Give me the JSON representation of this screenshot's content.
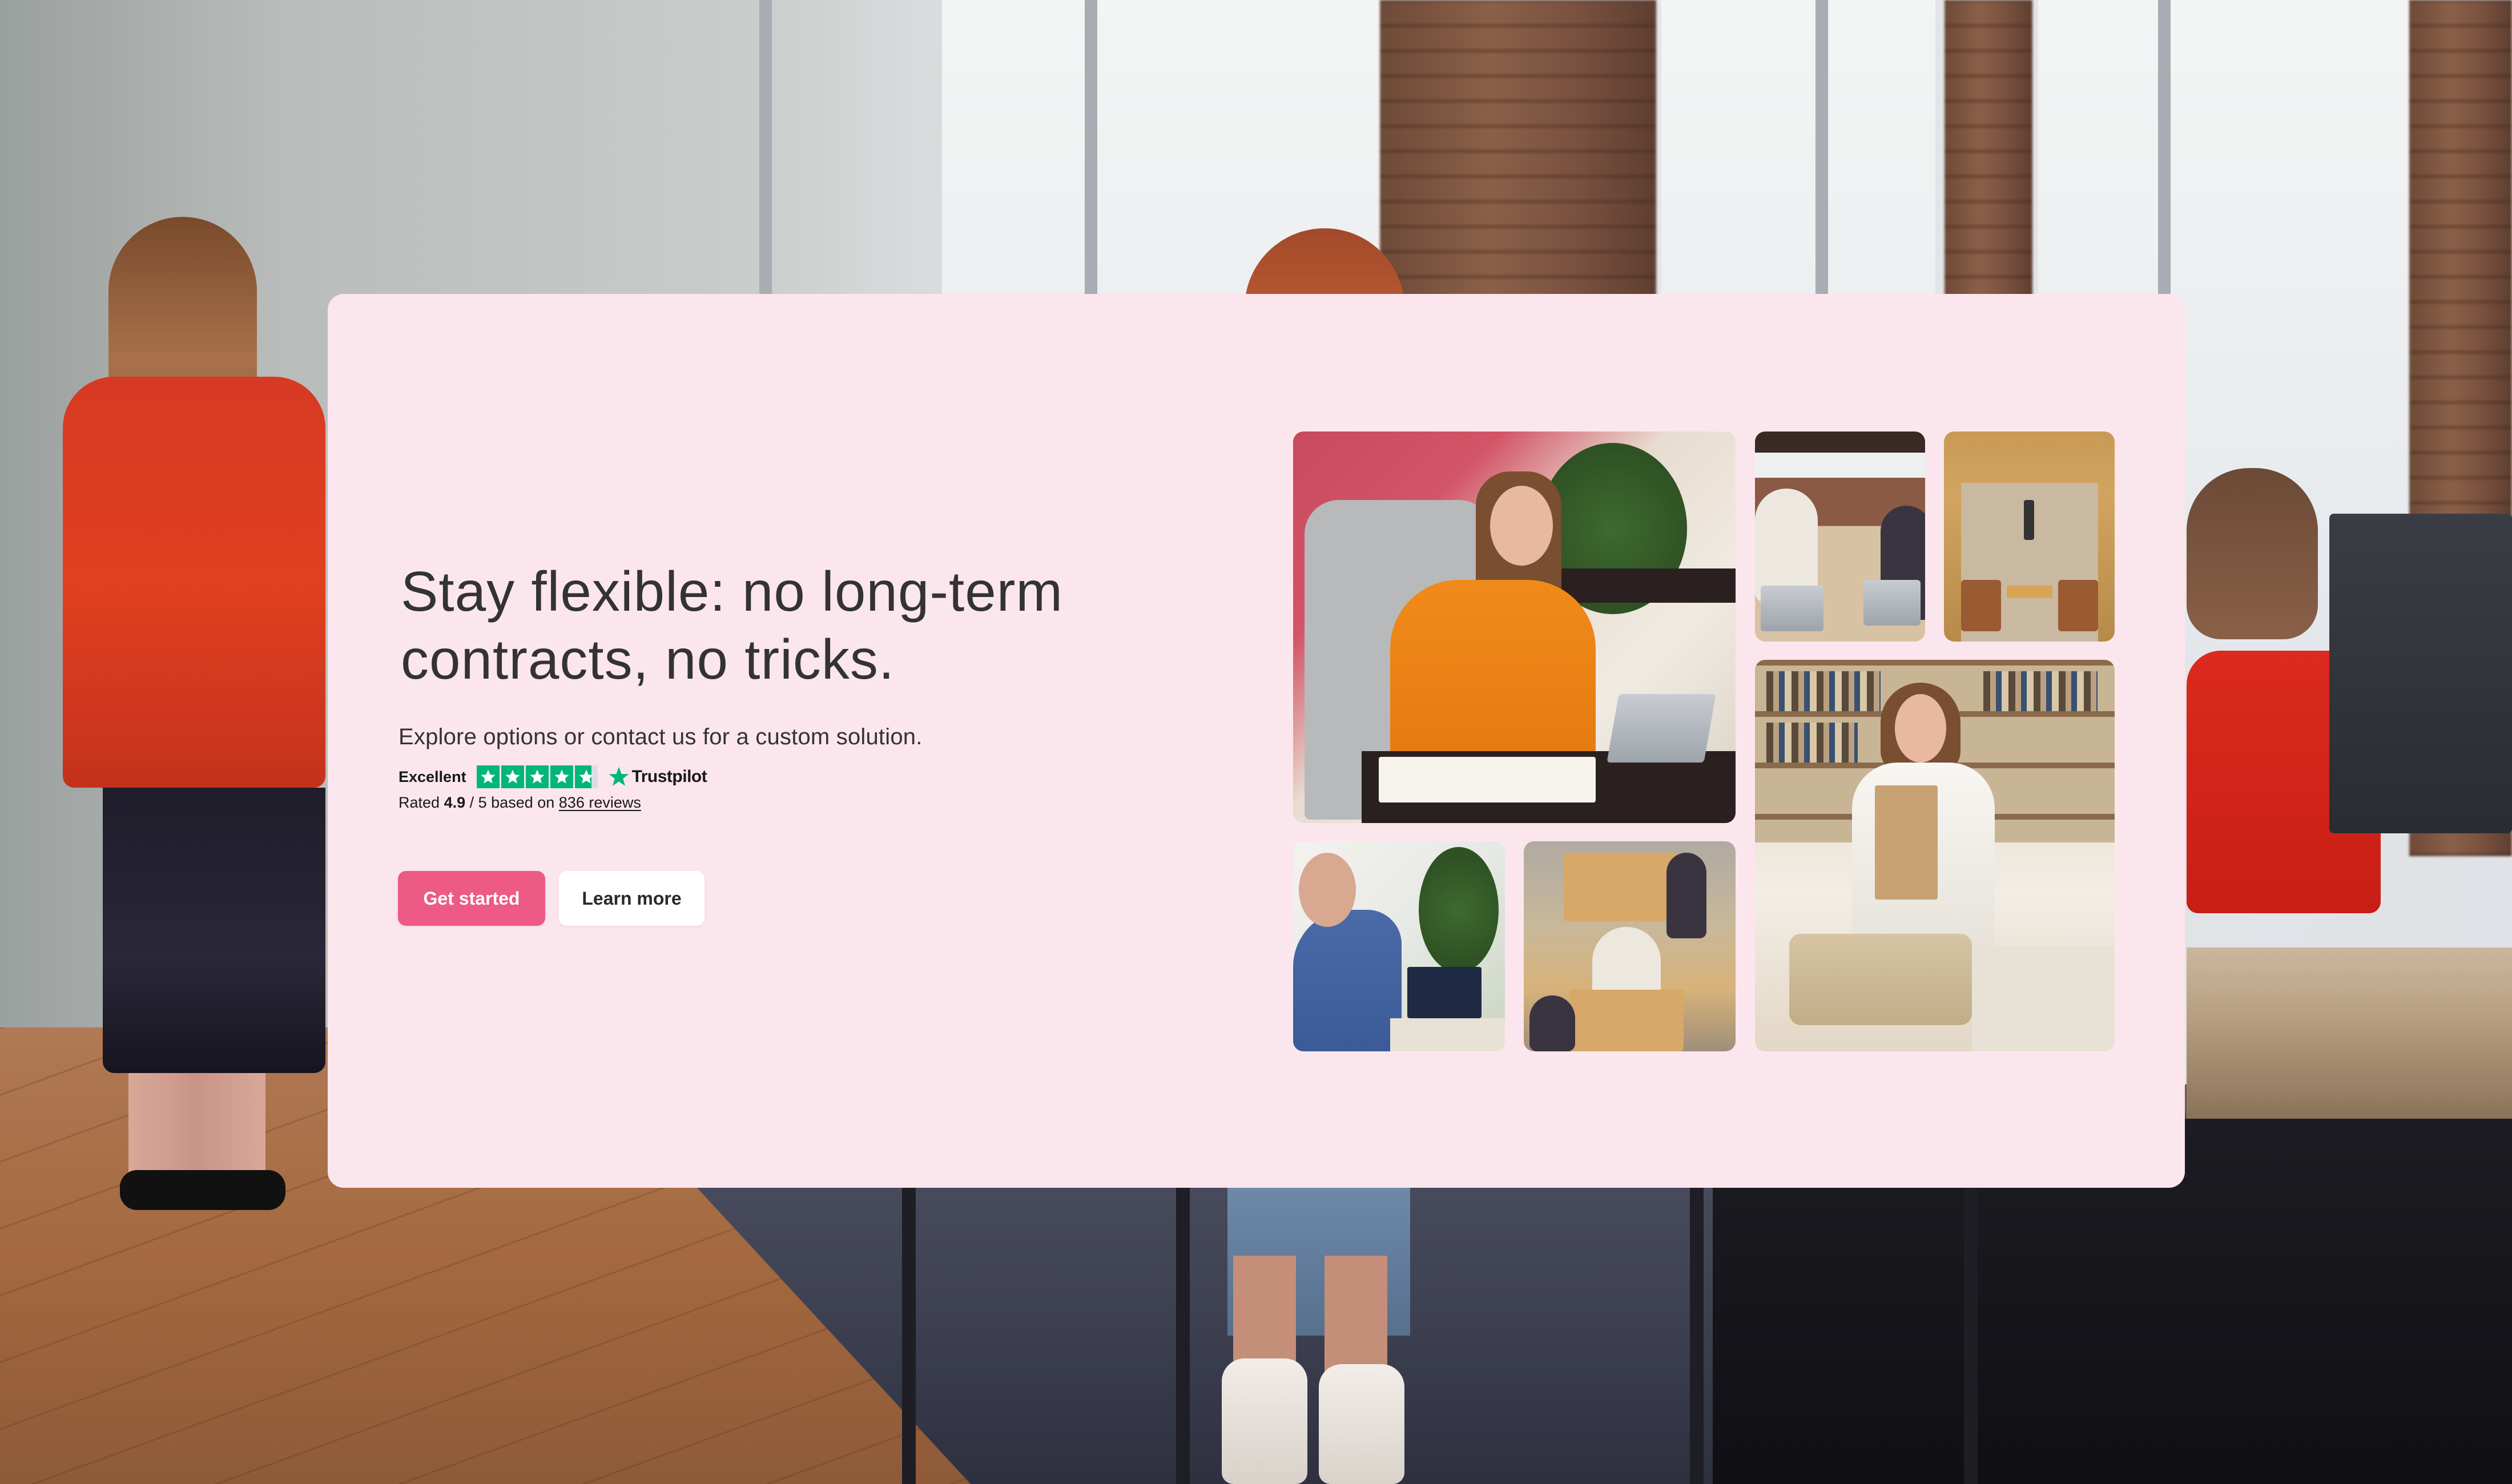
{
  "hero": {
    "headline": "Stay flexible: no long-term contracts, no tricks.",
    "subtitle": "Explore options or contact us for a custom solution.",
    "colors": {
      "card_background": "#FCE6EE",
      "primary_button": "#EC5A85",
      "text": "#333333",
      "trustpilot_green": "#00B67A"
    }
  },
  "trustpilot": {
    "label": "Excellent",
    "brand": "Trustpilot",
    "stars_out_of_5": 4.9,
    "rating_prefix": "Rated",
    "rating_value": "4.9",
    "rating_middle": "/ 5 based on",
    "reviews_link": "836 reviews",
    "star_icon": "star-icon"
  },
  "actions": {
    "primary_label": "Get started",
    "secondary_label": "Learn more"
  },
  "photos": [
    {
      "id": "woman-orange-sweater-laptop",
      "description": "Woman in orange sweater working on laptop in lounge chair"
    },
    {
      "id": "team-meeting-laptops",
      "description": "Team meeting around table with laptops"
    },
    {
      "id": "phone-booth",
      "description": "Wooden meeting booth with table and pendant lamp"
    },
    {
      "id": "woman-holding-folders",
      "description": "Woman in white shirt holding folders in office"
    },
    {
      "id": "video-call",
      "description": "Man on video call with laptop"
    },
    {
      "id": "overhead-meeting",
      "description": "Overhead view of group meeting with wheelchair user"
    }
  ]
}
